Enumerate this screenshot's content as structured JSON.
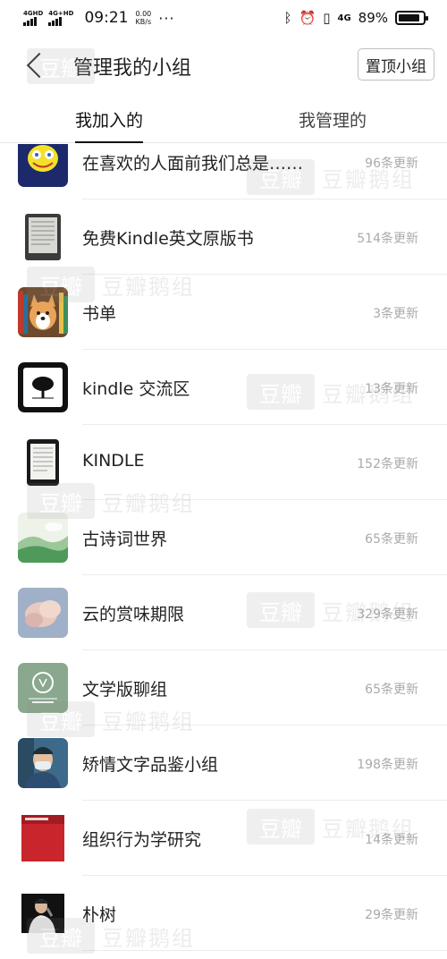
{
  "status": {
    "sim1": "4GHD",
    "sim2": "4G+HD",
    "time": "09:21",
    "speed_value": "0.00",
    "speed_unit": "KB/s",
    "more": "···",
    "net": "4G",
    "battery_text": "89%",
    "battery_level": 0.89
  },
  "nav": {
    "title": "管理我的小组",
    "pin_button": "置顶小组"
  },
  "tabs": [
    {
      "label": "我加入的",
      "active": true
    },
    {
      "label": "我管理的",
      "active": false
    }
  ],
  "groups": [
    {
      "name": "在喜欢的人面前我们总是……",
      "count": "96条更新",
      "icon": "spongebob-icon"
    },
    {
      "name": "免费Kindle英文原版书",
      "count": "514条更新",
      "icon": "kindle-device-icon"
    },
    {
      "name": "书单",
      "count": "3条更新",
      "icon": "corgi-bookshelf-icon"
    },
    {
      "name": "kindle 交流区",
      "count": "13条更新",
      "icon": "kindle-tree-logo-icon"
    },
    {
      "name": "KINDLE",
      "count": "152条更新",
      "icon": "kindle-paperwhite-icon"
    },
    {
      "name": "古诗词世界",
      "count": "65条更新",
      "icon": "landscape-icon"
    },
    {
      "name": "云的赏味期限",
      "count": "329条更新",
      "icon": "cloud-icon"
    },
    {
      "name": "文学版聊组",
      "count": "65条更新",
      "icon": "literature-badge-icon"
    },
    {
      "name": "矫情文字品鉴小组",
      "count": "198条更新",
      "icon": "masked-person-icon"
    },
    {
      "name": "组织行为学研究",
      "count": "14条更新",
      "icon": "red-book-cover-icon"
    },
    {
      "name": "朴树",
      "count": "29条更新",
      "icon": "singer-photo-icon"
    }
  ],
  "watermark": {
    "logo": "豆瓣",
    "text": "豆瓣鹅组"
  },
  "colors": {
    "text": "#222222",
    "muted": "#aaaaaa",
    "divider": "#ececec"
  }
}
